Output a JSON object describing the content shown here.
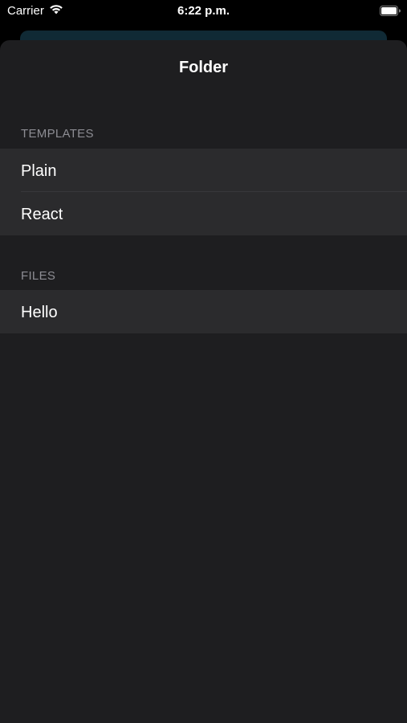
{
  "status_bar": {
    "carrier": "Carrier",
    "time": "6:22 p.m.",
    "wifi_icon": "wifi-icon",
    "battery_icon": "battery-icon"
  },
  "sheet": {
    "title": "Folder"
  },
  "sections": {
    "templates": {
      "header": "TEMPLATES",
      "items": [
        {
          "label": "Plain"
        },
        {
          "label": "React"
        }
      ]
    },
    "files": {
      "header": "FILES",
      "items": [
        {
          "label": "Hello"
        }
      ]
    }
  },
  "colors": {
    "sheet_background": "#1e1e20",
    "row_background": "#2b2b2d",
    "section_header": "#8d8d93",
    "text": "#ffffff"
  }
}
